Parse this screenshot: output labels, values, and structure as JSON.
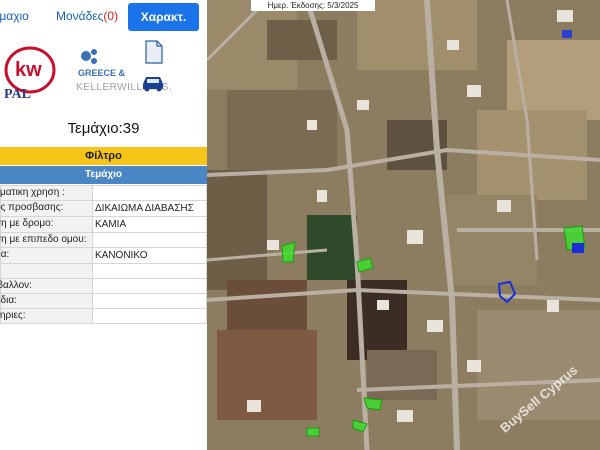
{
  "header": {
    "tab_parcel": "εμαχιο",
    "tab_units_label": "Μονάδες",
    "tab_units_count": "(0)",
    "features_button": "Χαρακτ."
  },
  "logos": {
    "kw_text": "KELLERWILLIAMS.",
    "watermark": "BuySell Cyprus"
  },
  "icons": {
    "kml": "kml-file-icon",
    "car": "car-icon",
    "kml_label": "KML"
  },
  "parcel": {
    "title": "Τεμάχιο:39"
  },
  "filter": {
    "label": "Φίλτρο"
  },
  "section": {
    "label": "Τεμάχιο"
  },
  "rows": [
    {
      "key": "γματικη χρηση :",
      "value": ""
    },
    {
      "key": "ος προσβασης:",
      "value": "ΔΙΚΑΙΩΜΑ ΔΙΑΒΑΣΗΣ"
    },
    {
      "key": "ση με δρομο:",
      "value": "ΚΑΜΙΑ"
    },
    {
      "key": "ση με επιπεδο ομου:",
      "value": ""
    },
    {
      "key": "μα:",
      "value": "ΚΑΝΟΝΙΚΟ"
    },
    {
      "key": ":",
      "value": ""
    },
    {
      "key": "ιβαλλον:",
      "value": ""
    },
    {
      "key": "οδια:",
      "value": ""
    },
    {
      "key": "ληριες:",
      "value": ""
    }
  ],
  "map": {
    "date": "Ημερ. Έκδοσης: 5/3/2025",
    "watermark": "BuySell Cyprus",
    "colors": {
      "parcel_highlight": "#3ddc2f",
      "selected_outline": "#1b2fd6",
      "roads": "#b9b0a3"
    }
  }
}
